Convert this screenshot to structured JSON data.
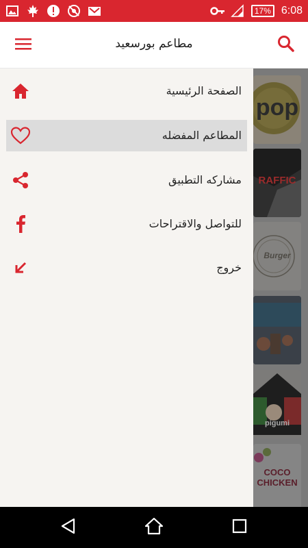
{
  "status_bar": {
    "battery": "17%",
    "time": "6:08",
    "icons": [
      "image-icon",
      "maple-leaf-icon",
      "alert-icon",
      "no-sync-icon",
      "gmail-icon",
      "key-icon",
      "signal-icon",
      "battery-icon"
    ]
  },
  "app_bar": {
    "title": "مطاعم بورسعيد",
    "menu_icon": "hamburger-icon",
    "search_icon": "search-icon"
  },
  "drawer": {
    "items": [
      {
        "label": "الصفحة الرئيسية",
        "icon": "home-icon",
        "active": false
      },
      {
        "label": "المطاعم المفضله",
        "icon": "heart-icon",
        "active": true
      },
      {
        "label": "مشاركه التطبيق",
        "icon": "share-icon",
        "active": false
      },
      {
        "label": "للتواصل والاقتراحات",
        "icon": "facebook-icon",
        "active": false
      },
      {
        "label": "خروج",
        "icon": "exit-arrow-icon",
        "active": false
      }
    ]
  },
  "restaurants": {
    "cards": [
      {
        "text": "pop"
      },
      {
        "text": "RAFFIC"
      },
      {
        "text": "Burger"
      },
      {
        "text": ""
      },
      {
        "text": "pigumi"
      },
      {
        "text": "COCO CHICKEN"
      }
    ]
  },
  "colors": {
    "accent": "#d9262f",
    "status_bar": "#d9262f",
    "drawer_bg": "#f6f4f1",
    "active_item": "#dcdcdc"
  },
  "nav_bar": {
    "icons": [
      "back-icon",
      "home-nav-icon",
      "recents-icon"
    ]
  }
}
